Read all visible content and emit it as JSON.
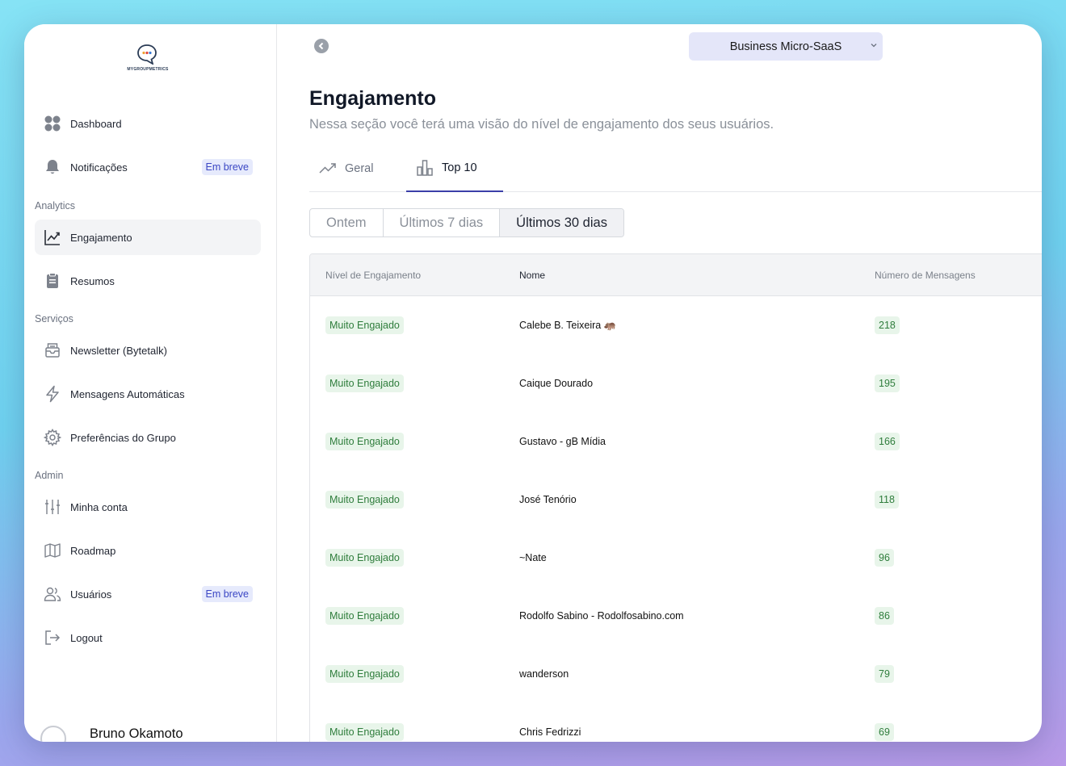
{
  "brand": {
    "logo_text": "MYGROUPMETRICS"
  },
  "sidebar": {
    "items": [
      {
        "label": "Dashboard",
        "icon": "dashboard-grid-icon"
      },
      {
        "label": "Notificações",
        "icon": "bell-icon",
        "badge": "Em breve"
      }
    ],
    "sections": [
      {
        "title": "Analytics",
        "items": [
          {
            "label": "Engajamento",
            "icon": "trend-chart-icon",
            "active": true
          },
          {
            "label": "Resumos",
            "icon": "clipboard-icon"
          }
        ]
      },
      {
        "title": "Serviços",
        "items": [
          {
            "label": "Newsletter (Bytetalk)",
            "icon": "newsletter-icon"
          },
          {
            "label": "Mensagens Automáticas",
            "icon": "lightning-icon"
          },
          {
            "label": "Preferências do Grupo",
            "icon": "gear-icon"
          }
        ]
      },
      {
        "title": "Admin",
        "items": [
          {
            "label": "Minha conta",
            "icon": "sliders-icon"
          },
          {
            "label": "Roadmap",
            "icon": "map-icon"
          },
          {
            "label": "Usuários",
            "icon": "users-icon",
            "badge": "Em breve"
          },
          {
            "label": "Logout",
            "icon": "logout-icon"
          }
        ]
      }
    ],
    "user": {
      "name": "Bruno Okamoto"
    }
  },
  "header": {
    "group_select": "Business Micro-SaaS"
  },
  "page": {
    "title": "Engajamento",
    "subtitle": "Nessa seção você terá uma visão do nível de engajamento dos seus usuários."
  },
  "tabs": [
    {
      "label": "Geral",
      "icon": "trend-icon",
      "active": false
    },
    {
      "label": "Top 10",
      "icon": "bar-chart-icon",
      "active": true
    }
  ],
  "periods": [
    {
      "label": "Ontem",
      "active": false
    },
    {
      "label": "Últimos 7 dias",
      "active": false
    },
    {
      "label": "Últimos 30 dias",
      "active": true
    }
  ],
  "table": {
    "headers": {
      "level": "Nível de Engajamento",
      "name": "Nome",
      "messages": "Número de Mensagens"
    },
    "rows": [
      {
        "level": "Muito Engajado",
        "name": "Calebe B. Teixeira 🦛",
        "messages": "218"
      },
      {
        "level": "Muito Engajado",
        "name": "Caique Dourado",
        "messages": "195"
      },
      {
        "level": "Muito Engajado",
        "name": "Gustavo - gB Mídia",
        "messages": "166"
      },
      {
        "level": "Muito Engajado",
        "name": "José Tenório",
        "messages": "118"
      },
      {
        "level": "Muito Engajado",
        "name": "~Nate",
        "messages": "96"
      },
      {
        "level": "Muito Engajado",
        "name": "Rodolfo Sabino - Rodolfosabino.com",
        "messages": "86"
      },
      {
        "level": "Muito Engajado",
        "name": "wanderson",
        "messages": "79"
      },
      {
        "level": "Muito Engajado",
        "name": "Chris Fedrizzi",
        "messages": "69"
      }
    ]
  },
  "colors": {
    "accent": "#3b3fa8",
    "tag_bg": "#e8f5ea",
    "tag_fg": "#2f7d3c",
    "badge_bg": "#e6eafc",
    "badge_fg": "#3b47c4"
  }
}
